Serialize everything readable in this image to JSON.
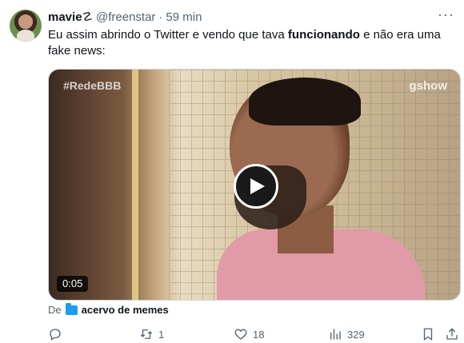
{
  "tweet": {
    "author_name": "mavie",
    "author_badge": "☡",
    "handle": "@freenstar",
    "separator": "·",
    "time": "59 min",
    "more_label": "···",
    "text_before": "Eu assim abrindo o Twitter e vendo que tava ",
    "text_bold": "funcionando",
    "text_after": " e não era uma fake news:"
  },
  "media": {
    "hashtag_overlay": "#RedeBBB",
    "brand_overlay": "gshow",
    "duration": "0:05"
  },
  "source": {
    "prefix": "De",
    "collection": "acervo de memes"
  },
  "actions": {
    "replies": "",
    "retweets": "1",
    "likes": "18",
    "views": "329"
  },
  "icons": {
    "reply": "reply-icon",
    "retweet": "retweet-icon",
    "like": "heart-icon",
    "views": "views-chart-icon",
    "bookmark": "bookmark-icon",
    "share": "share-icon",
    "play": "play-icon",
    "folder": "folder-icon"
  },
  "colors": {
    "accent": "#1d9bf0",
    "text": "#0f1419",
    "muted": "#536471"
  }
}
